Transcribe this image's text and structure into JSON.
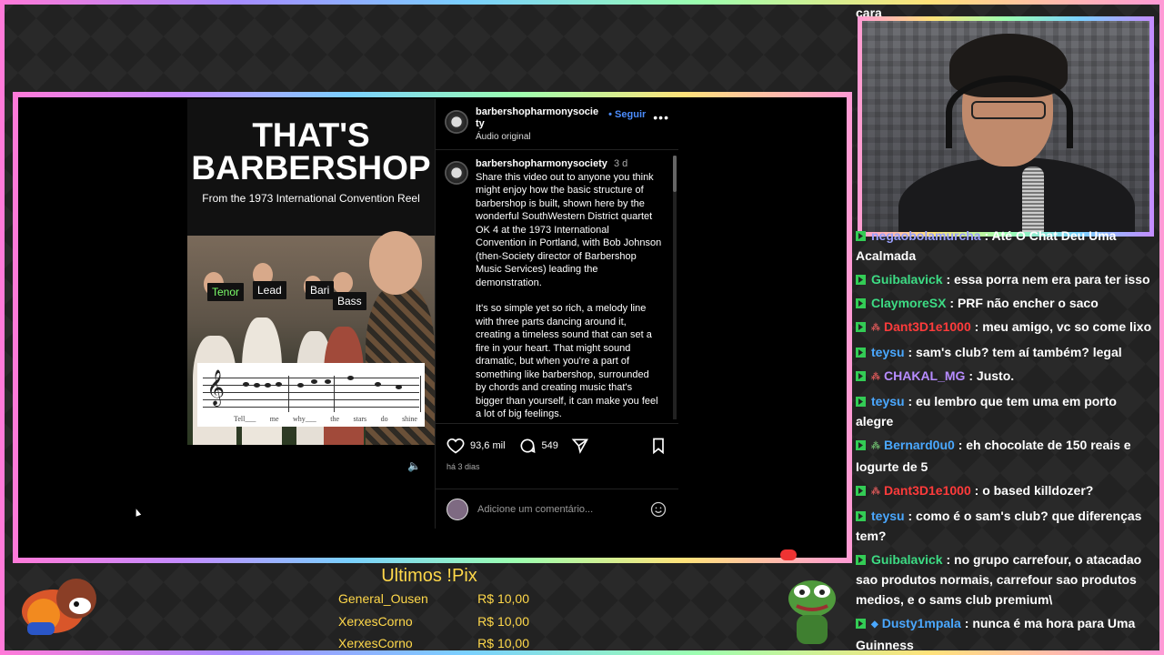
{
  "video": {
    "title": "THAT'S\nBARBERSHOP",
    "subtitle": "From the 1973 International Convention Reel",
    "voices": [
      "Tenor",
      "Lead",
      "Bari",
      "Bass"
    ],
    "lyrics": [
      "Tell___",
      "me",
      "why___",
      "the",
      "stars",
      "do",
      "shine"
    ]
  },
  "post": {
    "username": "barbershopharmonysociety",
    "follow": "• Seguir",
    "audio": "Áudio original",
    "caption_user": "barbershopharmonysociety",
    "caption_time": "3 d",
    "caption_p1": "Share this video out to anyone you think might enjoy how the basic structure of barbershop is built, shown here by the wonderful SouthWestern District quartet OK 4 at the 1973 International Convention in Portland, with Bob Johnson (then-Society director of Barbershop Music Services) leading the demonstration.",
    "caption_p2": "It's so simple yet so rich, a melody line with three parts dancing around it, creating a timeless sound that can set a fire in your heart. That might sound dramatic, but when you're a part of something like barbershop, surrounded by chords and creating music that's bigger than yourself, it can make you feel a lot of big feelings.",
    "likes": "93,6 mil",
    "comments": "549",
    "date": "há 3 dias",
    "comment_placeholder": "Adicione um comentário..."
  },
  "chat": {
    "top_fragment": "cara",
    "messages": [
      {
        "user": "negaobolamurcha",
        "color": "#9aa0ff",
        "text": "Até O Chat Deu Uma Acalmada",
        "badge": "none"
      },
      {
        "user": "Guibalavick",
        "color": "#3ddc84",
        "text": "essa porra nem era para ter isso",
        "badge": "none"
      },
      {
        "user": "ClaymoreSX",
        "color": "#3ddc84",
        "text": "PRF não encher o saco",
        "badge": "none"
      },
      {
        "user": "Dant3D1e1000",
        "color": "#ff3b3b",
        "text": "meu amigo, vc so come lixo",
        "badge": "red"
      },
      {
        "user": "teysu",
        "color": "#4aa8ff",
        "text": "sam's club? tem aí também? legal",
        "badge": "none"
      },
      {
        "user": "CHAKAL_MG",
        "color": "#b78cff",
        "text": "Justo.",
        "badge": "red"
      },
      {
        "user": "teysu",
        "color": "#4aa8ff",
        "text": "eu lembro que tem uma em porto alegre",
        "badge": "none"
      },
      {
        "user": "Bernard0u0",
        "color": "#4aa8ff",
        "text": "eh chocolate de 150 reais e Iogurte de 5",
        "badge": "green"
      },
      {
        "user": "Dant3D1e1000",
        "color": "#ff3b3b",
        "text": "o based killdozer?",
        "badge": "red"
      },
      {
        "user": "teysu",
        "color": "#4aa8ff",
        "text": "como é o sam's club? que diferenças tem?",
        "badge": "none"
      },
      {
        "user": "Guibalavick",
        "color": "#3ddc84",
        "text": "no grupo carrefour, o atacadao sao produtos normais, carrefour sao produtos medios, e o sams club premium\\",
        "badge": "none"
      },
      {
        "user": "Dusty1mpala",
        "color": "#4aa8ff",
        "text": "nunca é ma hora para Uma Guinness",
        "badge": "blue"
      }
    ]
  },
  "pix": {
    "title": "Ultimos !Pix",
    "rows": [
      {
        "name": "General_Ousen",
        "amount": "R$ 10,00"
      },
      {
        "name": "XerxesCorno",
        "amount": "R$ 10,00"
      },
      {
        "name": "XerxesCorno",
        "amount": "R$ 10,00"
      }
    ]
  }
}
